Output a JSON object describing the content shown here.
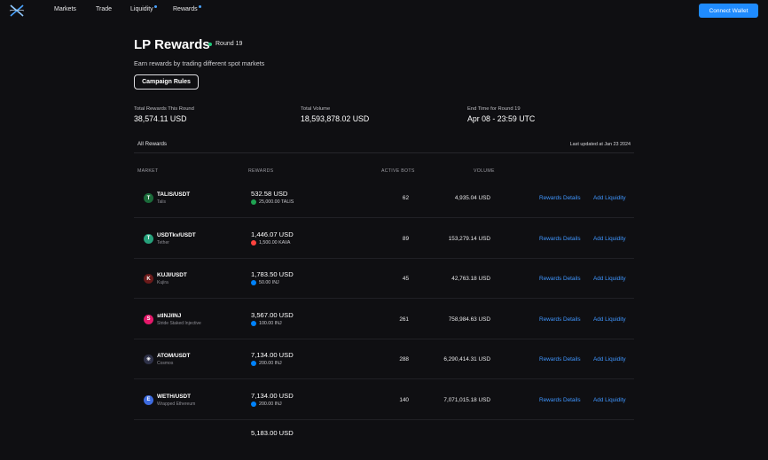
{
  "nav": {
    "items": [
      {
        "label": "Markets",
        "dot": false
      },
      {
        "label": "Trade",
        "dot": false
      },
      {
        "label": "Liquidity",
        "dot": true
      },
      {
        "label": "Rewards",
        "dot": true
      }
    ],
    "connect_label": "Connect Wallet",
    "accent": "#1f8bff"
  },
  "header": {
    "title": "LP Rewards",
    "round": "Round 19",
    "subtitle": "Earn rewards by trading different spot markets",
    "rules_label": "Campaign Rules"
  },
  "stats": [
    {
      "label": "Total Rewards This Round",
      "value": "38,574.11 USD"
    },
    {
      "label": "Total Volume",
      "value": "18,593,878.02 USD"
    },
    {
      "label": "End Time for Round 19",
      "value": "Apr 08 - 23:59 UTC"
    }
  ],
  "tabs": {
    "all": "All Rewards",
    "updated": "Last updated at Jan 23 2024"
  },
  "table": {
    "headers": {
      "market": "MARKET",
      "rewards": "REWARDS",
      "bots": "ACTIVE BOTS",
      "volume": "VOLUME"
    },
    "actions": {
      "details": "Rewards Details",
      "liquidity": "Add Liquidity"
    },
    "rows": [
      {
        "pair": "TALIS/USDT",
        "name": "Talis",
        "icon_color": "#1b6b3a",
        "glyph": "T",
        "rewards_usd": "532.58 USD",
        "token_amount": "25,000.00 TALIS",
        "token_color": "#1fa352",
        "bots": "62",
        "volume": "4,935.04 USD"
      },
      {
        "pair": "USDTkv/USDT",
        "name": "Tether",
        "icon_color": "#26a17b",
        "glyph": "T",
        "rewards_usd": "1,446.07 USD",
        "token_amount": "1,500.00 KAVA",
        "token_color": "#ff433e",
        "bots": "89",
        "volume": "153,279.14 USD"
      },
      {
        "pair": "KUJI/USDT",
        "name": "Kujira",
        "icon_color": "#6b1a1a",
        "glyph": "K",
        "rewards_usd": "1,783.50 USD",
        "token_amount": "50.00 INJ",
        "token_color": "#0082fa",
        "bots": "45",
        "volume": "42,763.18 USD"
      },
      {
        "pair": "stINJ/INJ",
        "name": "Stride Staked Injective",
        "icon_color": "#e5186a",
        "glyph": "S",
        "rewards_usd": "3,567.00 USD",
        "token_amount": "100.00 INJ",
        "token_color": "#0082fa",
        "bots": "261",
        "volume": "758,984.63 USD"
      },
      {
        "pair": "ATOM/USDT",
        "name": "Cosmos",
        "icon_color": "#2e3148",
        "glyph": "✳",
        "rewards_usd": "7,134.00 USD",
        "token_amount": "200.00 INJ",
        "token_color": "#0082fa",
        "bots": "288",
        "volume": "6,290,414.31 USD"
      },
      {
        "pair": "WETH/USDT",
        "name": "Wrapped Ethereum",
        "icon_color": "#3d6be0",
        "glyph": "E",
        "rewards_usd": "7,134.00 USD",
        "token_amount": "200.00 INJ",
        "token_color": "#0082fa",
        "bots": "140",
        "volume": "7,071,015.18 USD"
      }
    ],
    "partial_row_rewards": "5,183.00 USD"
  }
}
